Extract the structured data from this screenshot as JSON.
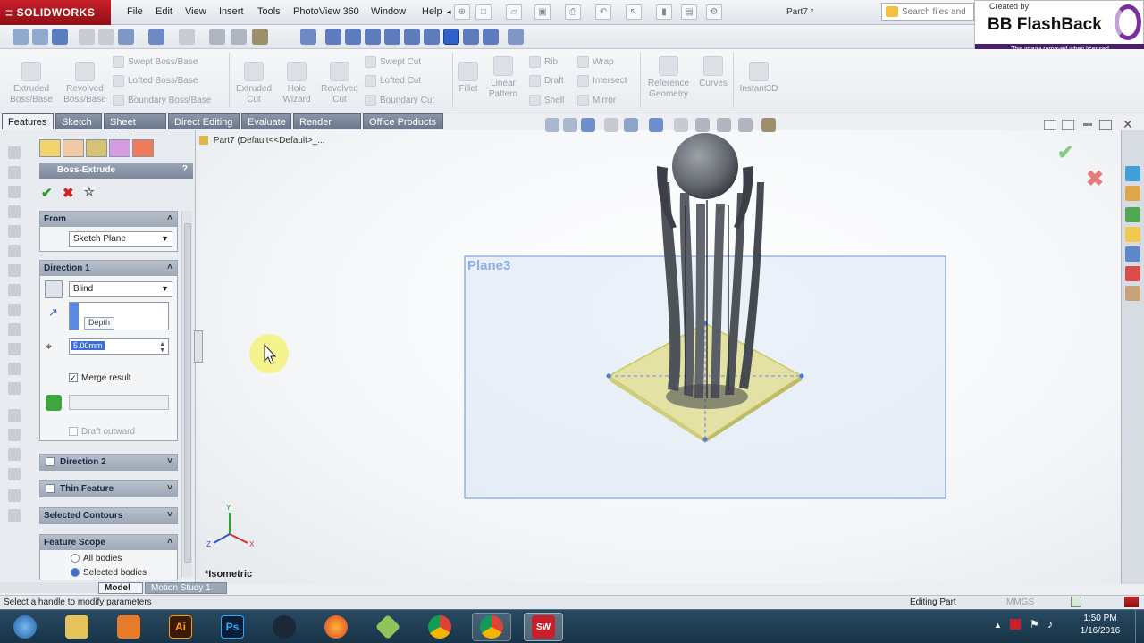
{
  "app": {
    "brand": "SOLIDWORKS",
    "menu": [
      "File",
      "Edit",
      "View",
      "Insert",
      "Tools",
      "PhotoView 360",
      "Window",
      "Help"
    ],
    "doc_title": "Part7 *",
    "search_placeholder": "Search files and"
  },
  "watermark": {
    "created_by": "Created by",
    "title": "BB FlashBack",
    "note": "This image removed when licensed"
  },
  "ribbon": {
    "large": [
      "Extruded\nBoss/Base",
      "Revolved\nBoss/Base",
      "Extruded\nCut",
      "Hole\nWizard",
      "Revolved\nCut",
      "Fillet",
      "Linear\nPattern",
      "Reference\nGeometry",
      "Curves",
      "Instant3D"
    ],
    "small_boss": [
      "Swept Boss/Base",
      "Lofted Boss/Base",
      "Boundary Boss/Base"
    ],
    "small_cut": [
      "Swept Cut",
      "Lofted Cut",
      "Boundary Cut"
    ],
    "small_feat1": [
      "Rib",
      "Draft",
      "Shell"
    ],
    "small_feat2": [
      "Wrap",
      "Intersect",
      "Mirror"
    ]
  },
  "tabs": [
    "Features",
    "Sketch",
    "Sheet Metal",
    "Direct Editing",
    "Evaluate",
    "Render Tools",
    "Office Products"
  ],
  "tree": {
    "root": "Part7  (Default<<Default>_..."
  },
  "property_manager": {
    "title": "Boss-Extrude",
    "help": "?",
    "from": {
      "label": "From",
      "value": "Sketch Plane"
    },
    "direction1": {
      "label": "Direction 1",
      "end_condition": "Blind",
      "depth_tooltip": "Depth",
      "depth_value": "5.00mm",
      "merge_result": "Merge result",
      "draft_outward": "Draft outward"
    },
    "direction2": "Direction 2",
    "thin_feature": "Thin Feature",
    "selected_contours": "Selected Contours",
    "feature_scope": {
      "label": "Feature Scope",
      "all_bodies": "All bodies",
      "selected_bodies": "Selected bodies"
    }
  },
  "viewport": {
    "plane_label": "Plane3",
    "view_orientation": "*Isometric",
    "axis_x": "X",
    "axis_y": "Y",
    "axis_z": "Z"
  },
  "bottom_tabs": [
    "Model",
    "Motion Study 1"
  ],
  "status": {
    "message": "Select a handle to modify parameters",
    "mode": "Editing Part",
    "units": "MMGS"
  },
  "taskbar": {
    "apps": [
      "start",
      "file-explorer",
      "sidefx",
      "illustrator",
      "photoshop",
      "steam",
      "firefox",
      "inkscape",
      "chrome",
      "chrome",
      "solidworks"
    ],
    "ai_label": "Ai",
    "ps_label": "Ps",
    "sw_label": "SW",
    "time": "1:50 PM",
    "date": "1/16/2016"
  },
  "colors": {
    "sw_red": "#c8202a",
    "plane_blue": "#6f95d8",
    "base_yellow": "#d9d87f",
    "model_gray": "#5f636b"
  }
}
